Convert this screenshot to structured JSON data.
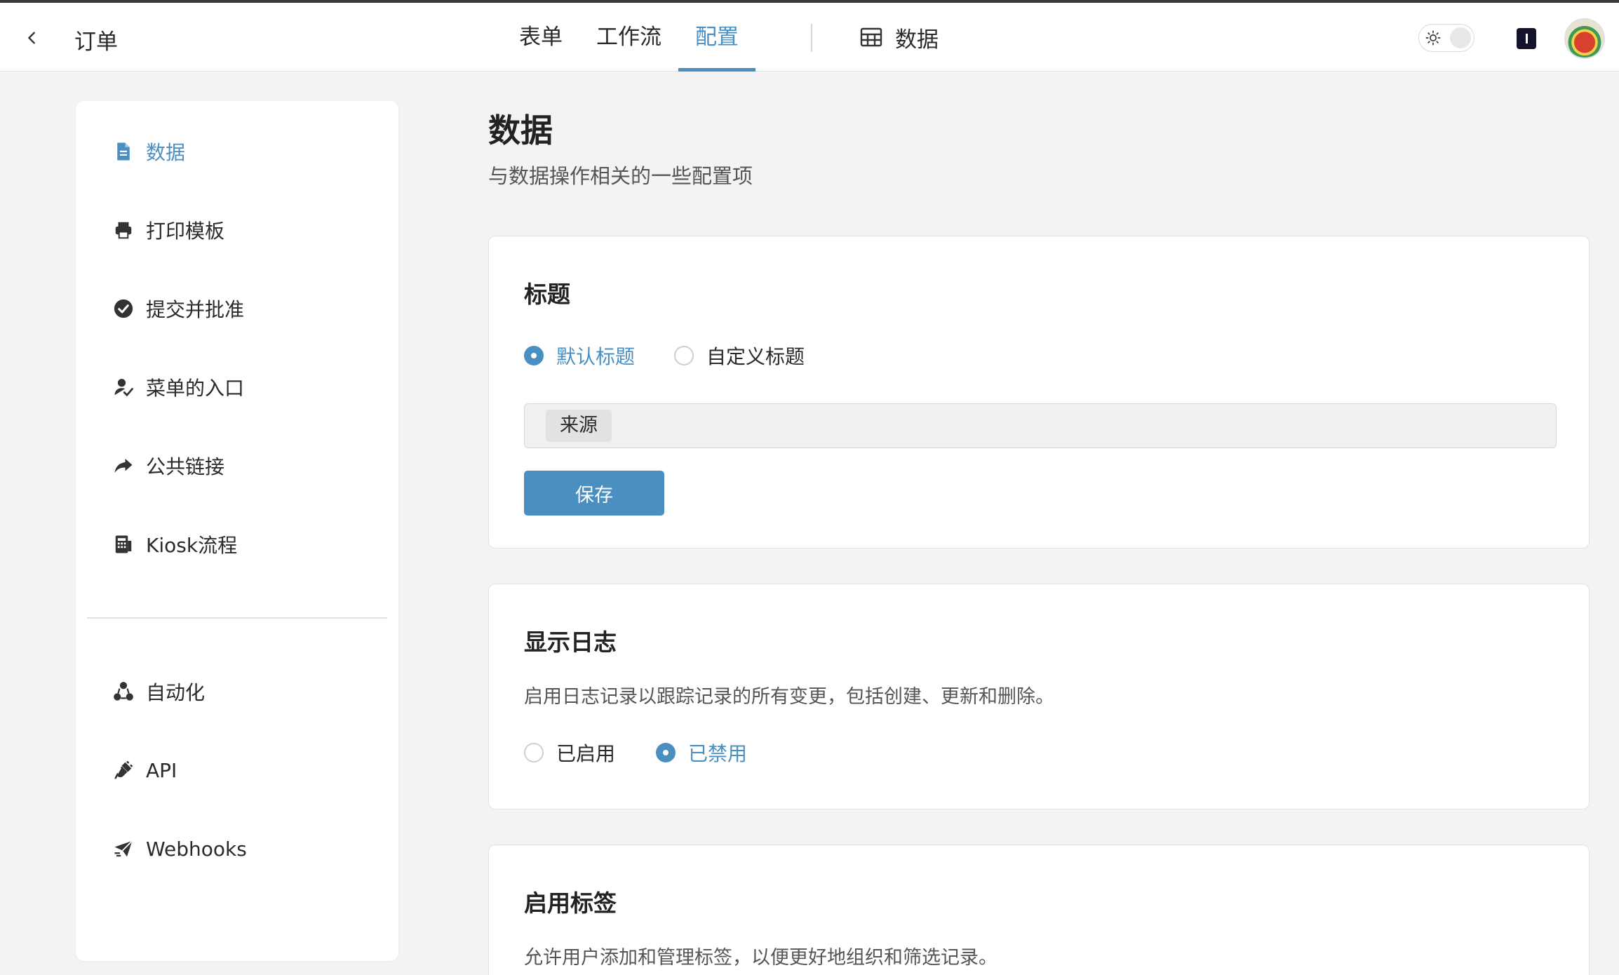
{
  "header": {
    "app_title": "订单",
    "tabs": [
      {
        "label": "表单",
        "active": false
      },
      {
        "label": "工作流",
        "active": false
      },
      {
        "label": "配置",
        "active": true
      }
    ],
    "data_tab_label": "数据",
    "accent_color": "#4a8fc2"
  },
  "sidebar": {
    "items": [
      {
        "label": "数据",
        "icon": "file-icon",
        "active": true
      },
      {
        "label": "打印模板",
        "icon": "printer-icon",
        "active": false
      },
      {
        "label": "提交并批准",
        "icon": "check-circle-icon",
        "active": false
      },
      {
        "label": "菜单的入口",
        "icon": "user-check-icon",
        "active": false
      },
      {
        "label": "公共链接",
        "icon": "share-icon",
        "active": false
      },
      {
        "label": "Kiosk流程",
        "icon": "kiosk-icon",
        "active": false
      },
      {
        "label": "自动化",
        "icon": "automation-icon",
        "active": false
      },
      {
        "label": "API",
        "icon": "plug-icon",
        "active": false
      },
      {
        "label": "Webhooks",
        "icon": "paper-plane-icon",
        "active": false
      }
    ]
  },
  "main": {
    "title": "数据",
    "subtitle": "与数据操作相关的一些配置项",
    "title_card": {
      "title": "标题",
      "options": [
        {
          "label": "默认标题",
          "checked": true
        },
        {
          "label": "自定义标题",
          "checked": false
        }
      ],
      "tag": "来源",
      "save_label": "保存"
    },
    "log_card": {
      "title": "显示日志",
      "description": "启用日志记录以跟踪记录的所有变更，包括创建、更新和删除。",
      "options": [
        {
          "label": "已启用",
          "checked": false
        },
        {
          "label": "已禁用",
          "checked": true
        }
      ]
    },
    "tags_card": {
      "title": "启用标签",
      "description": "允许用户添加和管理标签，以便更好地组织和筛选记录。"
    }
  }
}
